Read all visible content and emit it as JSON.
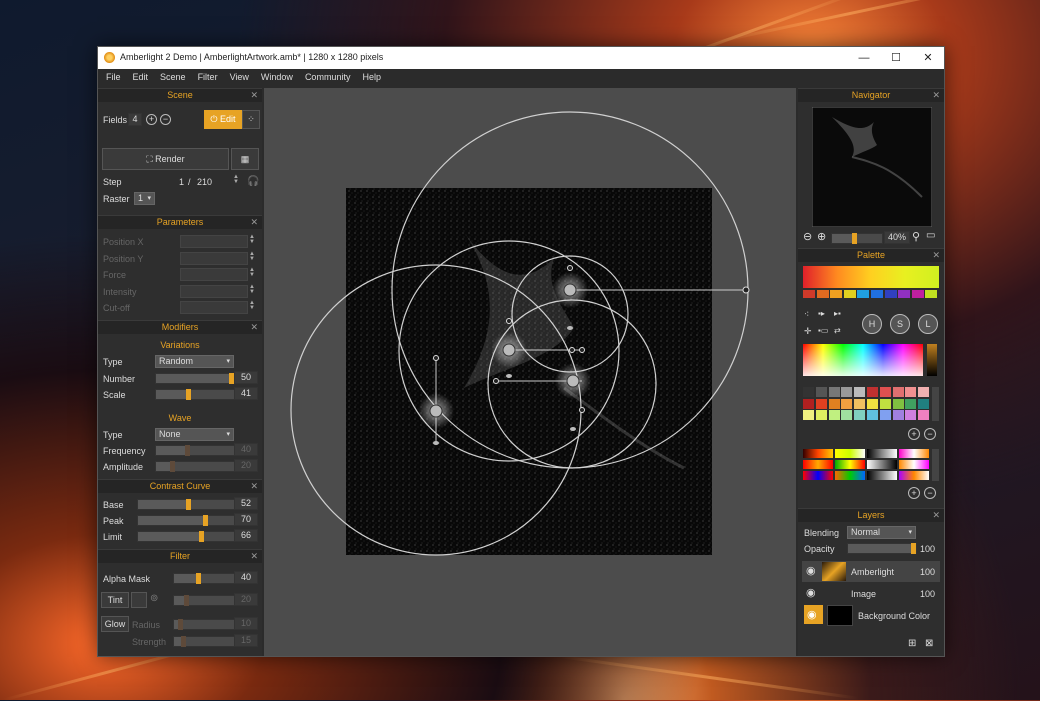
{
  "window": {
    "title": "Amberlight 2 Demo | AmberlightArtwork.amb* | 1280 x 1280 pixels",
    "controls": [
      "—",
      "☐",
      "✕"
    ]
  },
  "menu": [
    "File",
    "Edit",
    "Scene",
    "Filter",
    "View",
    "Window",
    "Community",
    "Help"
  ],
  "scene": {
    "header": "Scene",
    "fields_label": "Fields",
    "fields_value": "4",
    "edit_label": "Edit",
    "render_label": "Render",
    "step_label": "Step",
    "step_value": "1",
    "step_sep": "/",
    "step_total": "210",
    "raster_label": "Raster",
    "raster_value": "1"
  },
  "parameters": {
    "header": "Parameters",
    "rows": [
      "Position X",
      "Position Y",
      "Force",
      "Intensity",
      "Cut-off"
    ]
  },
  "modifiers": {
    "header": "Modifiers",
    "variations": {
      "title": "Variations",
      "type_label": "Type",
      "type_value": "Random",
      "number_label": "Number",
      "number_value": "50",
      "scale_label": "Scale",
      "scale_value": "41"
    },
    "wave": {
      "title": "Wave",
      "type_label": "Type",
      "type_value": "None",
      "frequency_label": "Frequency",
      "frequency_value": "40",
      "amplitude_label": "Amplitude",
      "amplitude_value": "20"
    }
  },
  "contrast": {
    "header": "Contrast Curve",
    "base_label": "Base",
    "base_value": "52",
    "peak_label": "Peak",
    "peak_value": "70",
    "limit_label": "Limit",
    "limit_value": "66"
  },
  "filter": {
    "header": "Filter",
    "alpha_label": "Alpha Mask",
    "alpha_value": "40",
    "tint_label": "Tint",
    "tint_value": "20",
    "glow_label": "Glow",
    "radius_label": "Radius",
    "radius_value": "10",
    "strength_label": "Strength",
    "strength_value": "15"
  },
  "navigator": {
    "header": "Navigator",
    "zoom_value": "40%"
  },
  "palette": {
    "header": "Palette",
    "swatches_top": [
      "#d03a2a",
      "#e06a20",
      "#f0a020",
      "#e0d020",
      "#20a0e0",
      "#2070e0",
      "#3040c0",
      "#9030c0",
      "#c020a0",
      "#c0e020"
    ],
    "btn_h": "H",
    "btn_s": "S",
    "btn_l": "L"
  },
  "layers": {
    "header": "Layers",
    "blending_label": "Blending",
    "blending_value": "Normal",
    "opacity_label": "Opacity",
    "opacity_value": "100",
    "items": [
      {
        "name": "Amberlight",
        "value": "100"
      },
      {
        "name": "Image",
        "value": "100"
      },
      {
        "name": "Background Color",
        "value": ""
      }
    ]
  }
}
